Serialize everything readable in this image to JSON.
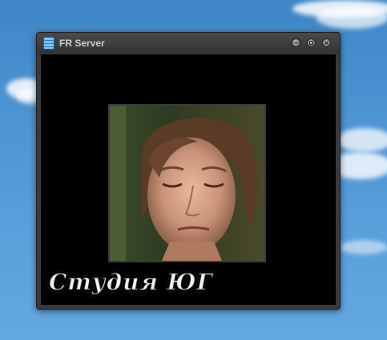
{
  "desktop": {
    "background_color": "#4d94d3"
  },
  "window": {
    "title": "FR Server",
    "icon": "server-icon",
    "controls": {
      "minimize": "minimize-icon",
      "maximize": "maximize-icon",
      "close": "close-icon"
    }
  },
  "video": {
    "background_color": "#000000",
    "watermark_text": "Студия ЮГ"
  }
}
